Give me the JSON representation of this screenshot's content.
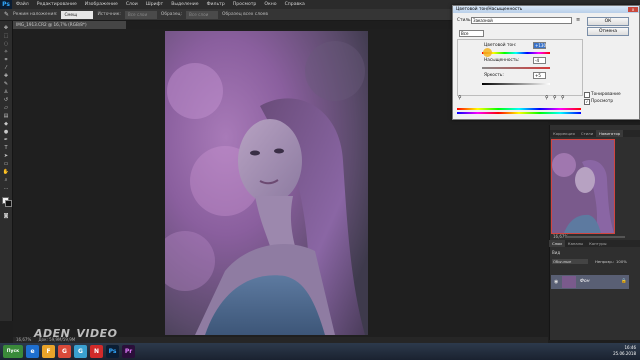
{
  "menu": {
    "logo": "Ps",
    "items": [
      "Файл",
      "Редактирование",
      "Изображение",
      "Слои",
      "Шрифт",
      "Выделение",
      "Фильтр",
      "Просмотр",
      "Окно",
      "Справка"
    ]
  },
  "options": {
    "mode_label": "Режим наложения:",
    "mode_value": "Смещ",
    "opacity_label": "Источник:",
    "opacity_value": "Все слои",
    "sample_label": "Образец:",
    "sample_value": "Все слои",
    "check_label": "Образец всех слоев"
  },
  "document": {
    "tab": "IMG_1913.CR2 @ 16,7% (RGB/8*)",
    "zoom": "16,67%",
    "doc_info": "Док: 59,9M/59,9M"
  },
  "watermark": "ADEN_VIDEO",
  "dialog": {
    "title": "Цветовой тон/Насыщенность",
    "close": "x",
    "preset_label": "Стиль:",
    "preset_value": "Заказной",
    "channel_value": "Все",
    "hue_label": "Цветовой тон:",
    "hue_value": "+130",
    "sat_label": "Насыщенность:",
    "sat_value": "-4",
    "light_label": "Яркость:",
    "light_value": "+5",
    "ok": "ОК",
    "cancel": "Отмена",
    "colorize": "Тонирование",
    "preview": "Просмотр",
    "preview_checked": "✓",
    "colorize_checked": ""
  },
  "panels": {
    "top_tabs": [
      "Коррекция",
      "Стили",
      "Навигатор"
    ],
    "zoom": "16,67%",
    "layer_tabs": [
      "Слои",
      "Каналы",
      "Контуры"
    ],
    "layer_kind": "Вид",
    "layer_blend": "Обычные",
    "layer_name": "Фон",
    "opacity_label": "Непрозр.:",
    "opacity_value": "100%"
  },
  "taskbar": {
    "start": "Пуск",
    "apps": [
      "e",
      "F",
      "G",
      "G",
      "N",
      "Ps",
      "Pr"
    ],
    "time": "16:46",
    "date": "25.06.2018"
  },
  "colors": {
    "accent": "#31a8ff",
    "nav_frame": "#d2453f",
    "dialog_bg": "#f0f0f0"
  }
}
